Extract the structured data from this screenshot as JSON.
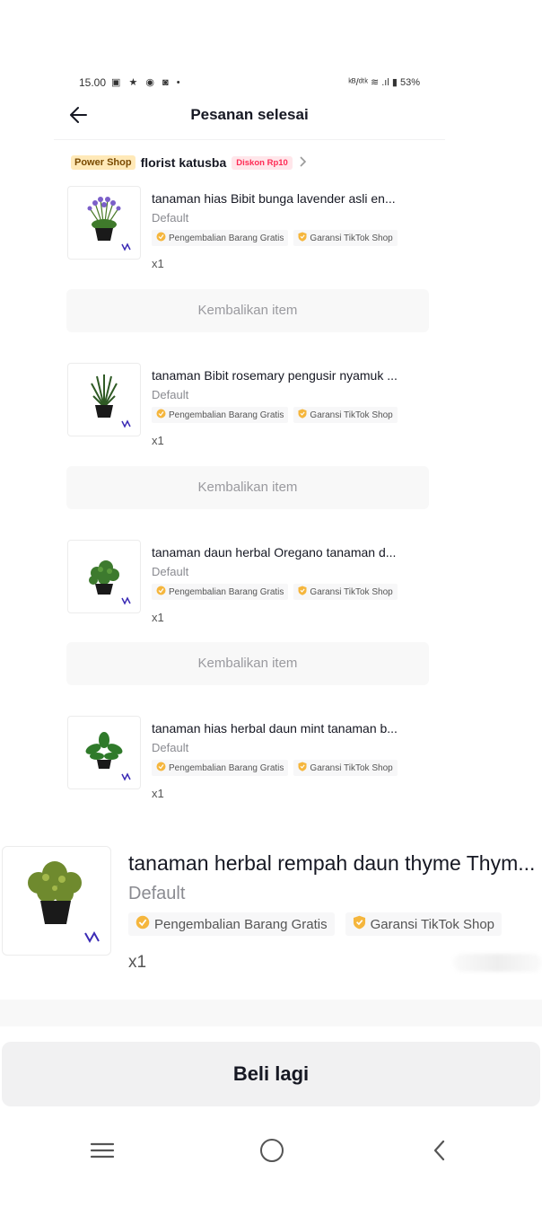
{
  "status_bar": {
    "time": "15.00",
    "notification_icons": "▣ ★ ◉ ◙ •",
    "right": "ᵏᴮ/ᵈᵗᵏ ≋ .ıl ▮ 53%"
  },
  "header": {
    "title": "Pesanan selesai"
  },
  "shop": {
    "badge": "Power Shop",
    "name": "florist katusba",
    "discount": "Diskon Rp10"
  },
  "tags": {
    "free_return": "Pengembalian Barang Gratis",
    "guarantee": "Garansi TikTok Shop"
  },
  "items": [
    {
      "name": "tanaman hias Bibit bunga lavender asli en...",
      "variant": "Default",
      "qty": "x1",
      "return_label": "Kembalikan item"
    },
    {
      "name": "tanaman Bibit rosemary pengusir nyamuk ...",
      "variant": "Default",
      "qty": "x1",
      "return_label": "Kembalikan item"
    },
    {
      "name": "tanaman daun herbal Oregano tanaman d...",
      "variant": "Default",
      "qty": "x1",
      "return_label": "Kembalikan item"
    },
    {
      "name": "tanaman hias herbal daun mint tanaman b...",
      "variant": "Default",
      "qty": "x1"
    }
  ],
  "zoomed_item": {
    "name": "tanaman herbal rempah daun thyme Thym...",
    "variant": "Default",
    "qty": "x1"
  },
  "buy_again_label": "Beli lagi",
  "colors": {
    "accent": "#fe2c55",
    "power_badge_bg": "#ffe9b8",
    "tag_icon": "#f5b63d",
    "button_bg": "#f1f1f2"
  },
  "icons": [
    "back-arrow-icon",
    "chevron-right-icon",
    "return-check-icon",
    "shield-icon",
    "recents-icon",
    "home-icon",
    "nav-back-icon"
  ]
}
